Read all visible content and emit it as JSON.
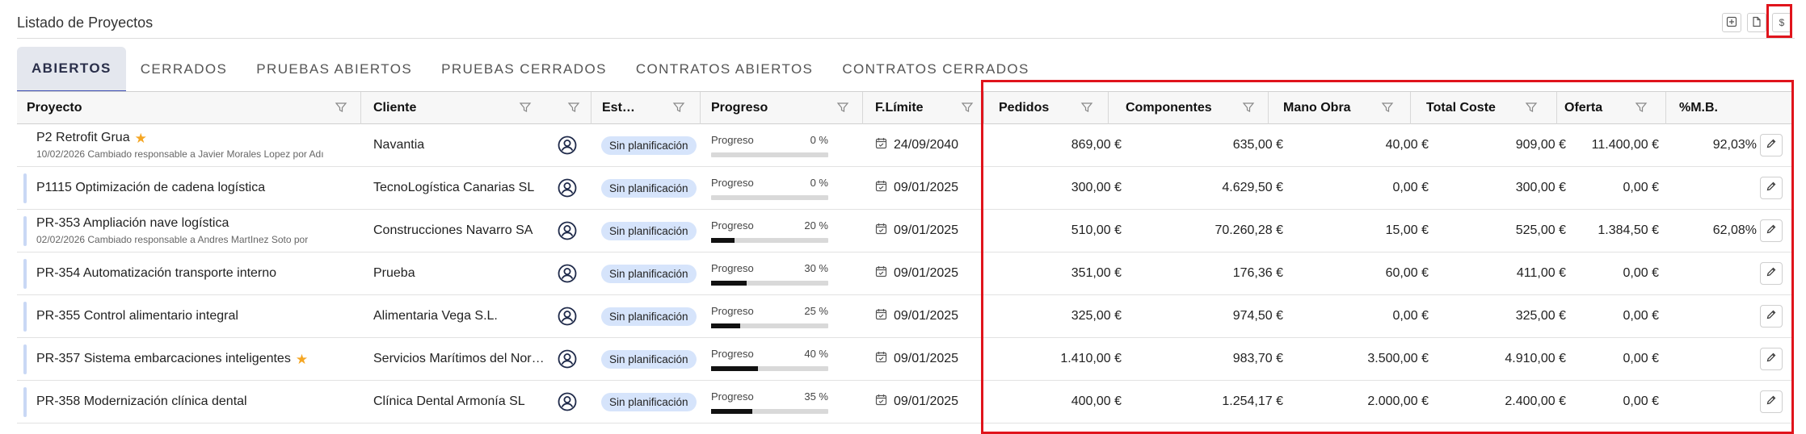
{
  "page": {
    "title": "Listado de Proyectos"
  },
  "header_buttons": [
    {
      "name": "add-icon",
      "label": ""
    },
    {
      "name": "document-icon",
      "label": ""
    },
    {
      "name": "currency-icon",
      "label": "$"
    }
  ],
  "tabs": [
    {
      "label": "ABIERTOS",
      "active": true
    },
    {
      "label": "CERRADOS",
      "active": false
    },
    {
      "label": "PRUEBAS ABIERTOS",
      "active": false
    },
    {
      "label": "PRUEBAS CERRADOS",
      "active": false
    },
    {
      "label": "CONTRATOS ABIERTOS",
      "active": false
    },
    {
      "label": "CONTRATOS CERRADOS",
      "active": false
    }
  ],
  "columns": {
    "proyecto": "Proyecto",
    "cliente": "Cliente",
    "estado": "Est…",
    "progreso": "Progreso",
    "flimite": "F.Límite",
    "pedidos": "Pedidos",
    "componentes": "Componentes",
    "mano_obra": "Mano Obra",
    "total_coste": "Total Coste",
    "oferta": "Oferta",
    "mb": "%M.B."
  },
  "progress_label": "Progreso",
  "rows": [
    {
      "name": "P2 Retrofit Grua",
      "star": true,
      "sub": "10/02/2026 Cambiado responsable a Javier Morales Lopez por Adı",
      "client": "Navantia",
      "status": "Sin planificación",
      "progress_text": "0 %",
      "progress": 0,
      "date": "24/09/2040",
      "pedidos": "869,00 €",
      "componentes": "635,00 €",
      "mano_obra": "40,00 €",
      "total_coste": "909,00 €",
      "oferta": "11.400,00 €",
      "mb": "92,03%"
    },
    {
      "name": "P1115 Optimización de cadena logística",
      "star": false,
      "sub": "",
      "client": "TecnoLogística Canarias SL",
      "status": "Sin planificación",
      "progress_text": "0 %",
      "progress": 0,
      "date": "09/01/2025",
      "pedidos": "300,00 €",
      "componentes": "4.629,50 €",
      "mano_obra": "0,00 €",
      "total_coste": "300,00 €",
      "oferta": "0,00 €",
      "mb": ""
    },
    {
      "name": "PR-353 Ampliación nave logística",
      "star": false,
      "sub": "02/02/2026 Cambiado responsable a Andres MartInez Soto por",
      "client": "Construcciones Navarro SA",
      "status": "Sin planificación",
      "progress_text": "20 %",
      "progress": 20,
      "date": "09/01/2025",
      "pedidos": "510,00 €",
      "componentes": "70.260,28 €",
      "mano_obra": "15,00 €",
      "total_coste": "525,00 €",
      "oferta": "1.384,50 €",
      "mb": "62,08%"
    },
    {
      "name": "PR-354 Automatización transporte interno",
      "star": false,
      "sub": "",
      "client": "Prueba",
      "status": "Sin planificación",
      "progress_text": "30 %",
      "progress": 30,
      "date": "09/01/2025",
      "pedidos": "351,00 €",
      "componentes": "176,36 €",
      "mano_obra": "60,00 €",
      "total_coste": "411,00 €",
      "oferta": "0,00 €",
      "mb": ""
    },
    {
      "name": "PR-355 Control alimentario integral",
      "star": false,
      "sub": "",
      "client": "Alimentaria Vega S.L.",
      "status": "Sin planificación",
      "progress_text": "25 %",
      "progress": 25,
      "date": "09/01/2025",
      "pedidos": "325,00 €",
      "componentes": "974,50 €",
      "mano_obra": "0,00 €",
      "total_coste": "325,00 €",
      "oferta": "0,00 €",
      "mb": ""
    },
    {
      "name": "PR-357 Sistema embarcaciones inteligentes",
      "star": true,
      "sub": "",
      "client": "Servicios Marítimos del Nor…",
      "status": "Sin planificación",
      "progress_text": "40 %",
      "progress": 40,
      "date": "09/01/2025",
      "pedidos": "1.410,00 €",
      "componentes": "983,70 €",
      "mano_obra": "3.500,00 €",
      "total_coste": "4.910,00 €",
      "oferta": "0,00 €",
      "mb": ""
    },
    {
      "name": "PR-358 Modernización clínica dental",
      "star": false,
      "sub": "",
      "client": "Clínica Dental Armonía SL",
      "status": "Sin planificación",
      "progress_text": "35 %",
      "progress": 35,
      "date": "09/01/2025",
      "pedidos": "400,00 €",
      "componentes": "1.254,17 €",
      "mano_obra": "2.000,00 €",
      "total_coste": "2.400,00 €",
      "oferta": "0,00 €",
      "mb": ""
    }
  ],
  "colors": {
    "accent": "#3f51b5",
    "highlight": "#e0141c",
    "badge_bg": "#d6e4fb",
    "star": "#f5a623"
  }
}
